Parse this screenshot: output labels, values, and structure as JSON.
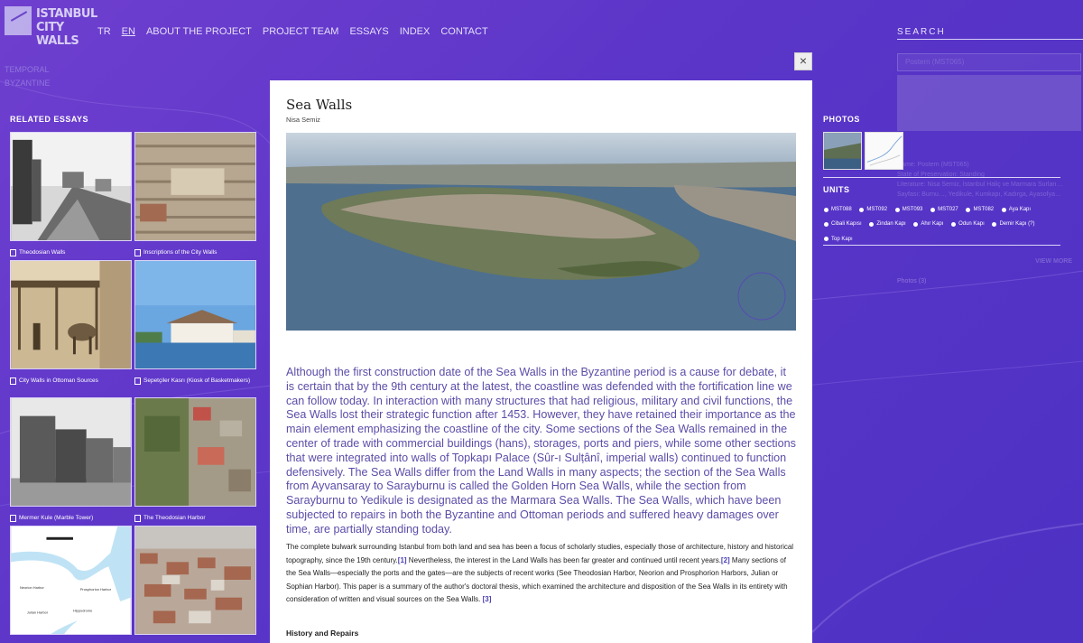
{
  "logo": {
    "line1": "ISTANBUL",
    "line2": "CITY WALLS"
  },
  "nav": [
    {
      "label": "TR",
      "active": false
    },
    {
      "label": "EN",
      "active": true
    },
    {
      "label": "ABOUT THE PROJECT",
      "active": false
    },
    {
      "label": "PROJECT TEAM",
      "active": false
    },
    {
      "label": "ESSAYS",
      "active": false
    },
    {
      "label": "INDEX",
      "active": false
    },
    {
      "label": "CONTACT",
      "active": false
    }
  ],
  "search": {
    "label": "SEARCH"
  },
  "background_left": [
    "TEMPORAL",
    "BYZANTINE"
  ],
  "related_essays": {
    "title": "RELATED ESSAYS",
    "items": [
      {
        "label": "Theodosian Walls"
      },
      {
        "label": "Inscriptions of the City Walls"
      },
      {
        "label": "City Walls in Ottoman Sources"
      },
      {
        "label": "Sepetçiler Kasrı (Kiosk of Basketmakers)"
      },
      {
        "label": "Mermer Kule (Marble Tower)"
      },
      {
        "label": "The Theodosian Harbor"
      },
      {
        "label": ""
      },
      {
        "label": ""
      }
    ],
    "map_labels": [
      "Neorion Harbor",
      "Prosphorion Harbor",
      "Julian Harbor",
      "Hippodrome"
    ]
  },
  "modal": {
    "close_label": "×",
    "title": "Sea Walls",
    "author": "Nisa Semiz",
    "lead": "Although the first construction date of the Sea Walls in the Byzantine period is a cause for debate, it is certain that by the 9th century at the latest, the coastline was defended with the fortification line we can follow today. In interaction with many structures that had religious, military and civil functions, the Sea Walls lost their strategic function after 1453. However, they have retained their importance as the main element emphasizing the coastline of the city. Some sections of the Sea Walls remained in the center of trade with commercial buildings (hans), storages, ports and piers, while some other sections that were integrated into walls of Topkapı Palace (Sûr-ı Sulṭânî, imperial walls) continued to function defensively. The Sea Walls differ from the Land Walls in many aspects; the section of the Sea Walls from Ayvansaray to Sarayburnu is called the Golden Horn Sea Walls, while the section from Sarayburnu to Yedikule is designated as the Marmara Sea Walls. The Sea Walls, which have been subjected to repairs in both the Byzantine and Ottoman periods and suffered heavy damages over time, are partially standing today.",
    "body_1": "The complete bulwark surrounding Istanbul from both land and sea has been a focus of scholarly studies, especially those of architecture, history and historical topography, since the 19th century.",
    "ref_1": "[1]",
    "body_2": " Nevertheless, the interest in the Land Walls has been far greater and continued until recent years.",
    "ref_2": "[2]",
    "body_3": " Many sections of the Sea Walls—especially the ports and the gates—are the subjects of recent works (See Theodosian Harbor, Neorion and Prosphorion Harbors, Julian or Sophian Harbor). This paper is a summary of the author's doctoral thesis, which examined the architecture and disposition of the Sea Walls in its entirety with consideration of written and visual sources on the Sea Walls.",
    "ref_3": "[3]",
    "subheading": "History and Repairs"
  },
  "photos": {
    "title": "PHOTOS"
  },
  "units": {
    "title": "UNITS",
    "items": [
      "MST088",
      "MST092",
      "MST093",
      "MST027",
      "MST082",
      "Aya Kapı",
      "Cibali Kapısı",
      "Zindan Kapı",
      "Ahır Kapı",
      "Odun Kapı",
      "Demir Kapı (?)",
      "Top Kapı"
    ]
  },
  "background_right": {
    "input_value": "Postern (MST065)",
    "info": [
      "Name: Postern (MST065)",
      "State of Preservation: Standing",
      "Literature: Nisa Semiz, İstanbul Haliç ve Marmara Surları…",
      "Sayfası: Burnu…, Yedikule, Kumkapı, Kadırga, Ayasofya…"
    ],
    "view_more": "VIEW MORE",
    "photos_label": "Photos (3)"
  },
  "colors": {
    "background": "#5a35c8",
    "lead_text": "#5b4da8",
    "ref_link": "#4a3fb5"
  }
}
